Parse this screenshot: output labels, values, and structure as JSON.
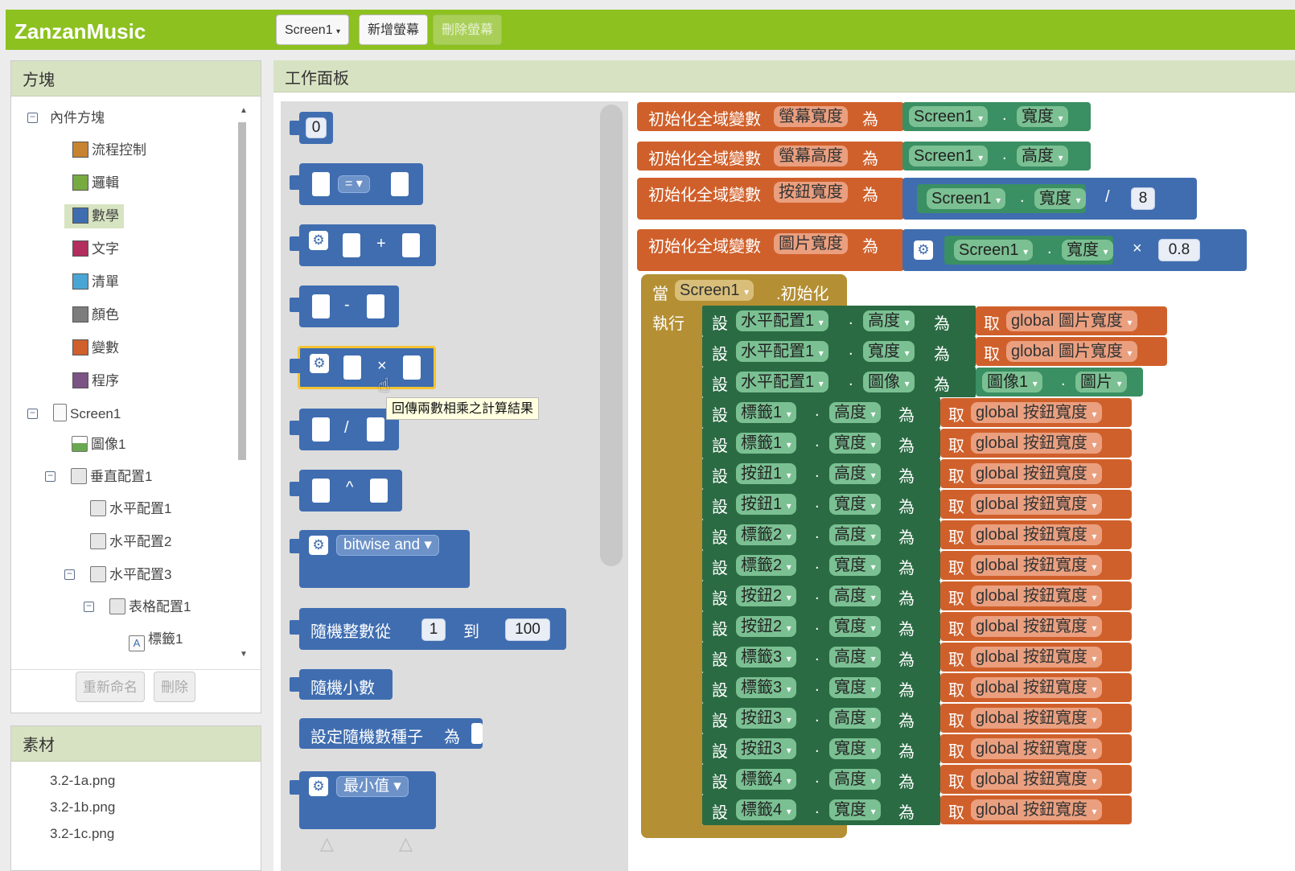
{
  "app": {
    "title": "ZanzanMusic"
  },
  "toolbar": {
    "screen_select": "Screen1",
    "add_screen": "新增螢幕",
    "remove_screen": "刪除螢幕"
  },
  "blocks_panel": {
    "title": "方塊",
    "builtin": "內件方塊",
    "categories": [
      {
        "label": "流程控制",
        "color": "#c88330"
      },
      {
        "label": "邏輯",
        "color": "#77ab41"
      },
      {
        "label": "數學",
        "color": "#3f6db0"
      },
      {
        "label": "文字",
        "color": "#b32d5e"
      },
      {
        "label": "清單",
        "color": "#49a6d4"
      },
      {
        "label": "顏色",
        "color": "#7d7d7d"
      },
      {
        "label": "變數",
        "color": "#d0602b"
      },
      {
        "label": "程序",
        "color": "#7c5385"
      }
    ],
    "components": {
      "screen": "Screen1",
      "image": "圖像1",
      "vertical": "垂直配置1",
      "horizontal1": "水平配置1",
      "horizontal2": "水平配置2",
      "horizontal3": "水平配置3",
      "table": "表格配置1",
      "label1": "標籤1"
    },
    "rename_button": "重新命名",
    "delete_button": "刪除"
  },
  "media_panel": {
    "title": "素材",
    "files": [
      "3.2-1a.png",
      "3.2-1b.png",
      "3.2-1c.png"
    ]
  },
  "workspace": {
    "title": "工作面板"
  },
  "flyout": {
    "number": "0",
    "eq": "=",
    "plus": "+",
    "minus": "-",
    "times": "×",
    "divide": "/",
    "power": "^",
    "bitwise": "bitwise and",
    "random_int": {
      "label": "隨機整數從",
      "from": "1",
      "to_label": "到",
      "to": "100"
    },
    "random_frac": "隨機小數",
    "random_seed": {
      "label": "設定隨機數種子",
      "suffix": "為"
    },
    "min": "最小值",
    "tooltip": "回傳兩數相乘之計算結果"
  },
  "code": {
    "init_label": "初始化全域變數",
    "as": "為",
    "globals": [
      {
        "name": "螢幕寬度",
        "component": "Screen1",
        "prop": "寬度"
      },
      {
        "name": "螢幕高度",
        "component": "Screen1",
        "prop": "高度"
      },
      {
        "name": "按鈕寬度",
        "component": "Screen1",
        "prop": "寬度",
        "op": "/",
        "operand": "8"
      },
      {
        "name": "圖片寬度",
        "component": "Screen1",
        "prop": "寬度",
        "op": "×",
        "operand": "0.8"
      }
    ],
    "event": {
      "when": "當",
      "component": "Screen1",
      "event": ".初始化",
      "do": "執行"
    },
    "set": "設",
    "get": "取",
    "statements": [
      {
        "component": "水平配置1",
        "prop": "高度",
        "kind": "get",
        "value": "global 圖片寬度"
      },
      {
        "component": "水平配置1",
        "prop": "寬度",
        "kind": "get",
        "value": "global 圖片寬度"
      },
      {
        "component": "水平配置1",
        "prop": "圖像",
        "kind": "comp",
        "value_comp": "圖像1",
        "value_prop": "圖片"
      },
      {
        "component": "標籤1",
        "prop": "高度",
        "kind": "get",
        "value": "global 按鈕寬度"
      },
      {
        "component": "標籤1",
        "prop": "寬度",
        "kind": "get",
        "value": "global 按鈕寬度"
      },
      {
        "component": "按鈕1",
        "prop": "高度",
        "kind": "get",
        "value": "global 按鈕寬度"
      },
      {
        "component": "按鈕1",
        "prop": "寬度",
        "kind": "get",
        "value": "global 按鈕寬度"
      },
      {
        "component": "標籤2",
        "prop": "高度",
        "kind": "get",
        "value": "global 按鈕寬度"
      },
      {
        "component": "標籤2",
        "prop": "寬度",
        "kind": "get",
        "value": "global 按鈕寬度"
      },
      {
        "component": "按鈕2",
        "prop": "高度",
        "kind": "get",
        "value": "global 按鈕寬度"
      },
      {
        "component": "按鈕2",
        "prop": "寬度",
        "kind": "get",
        "value": "global 按鈕寬度"
      },
      {
        "component": "標籤3",
        "prop": "高度",
        "kind": "get",
        "value": "global 按鈕寬度"
      },
      {
        "component": "標籤3",
        "prop": "寬度",
        "kind": "get",
        "value": "global 按鈕寬度"
      },
      {
        "component": "按鈕3",
        "prop": "高度",
        "kind": "get",
        "value": "global 按鈕寬度"
      },
      {
        "component": "按鈕3",
        "prop": "寬度",
        "kind": "get",
        "value": "global 按鈕寬度"
      },
      {
        "component": "標籤4",
        "prop": "高度",
        "kind": "get",
        "value": "global 按鈕寬度"
      },
      {
        "component": "標籤4",
        "prop": "寬度",
        "kind": "get",
        "value": "global 按鈕寬度"
      }
    ]
  }
}
